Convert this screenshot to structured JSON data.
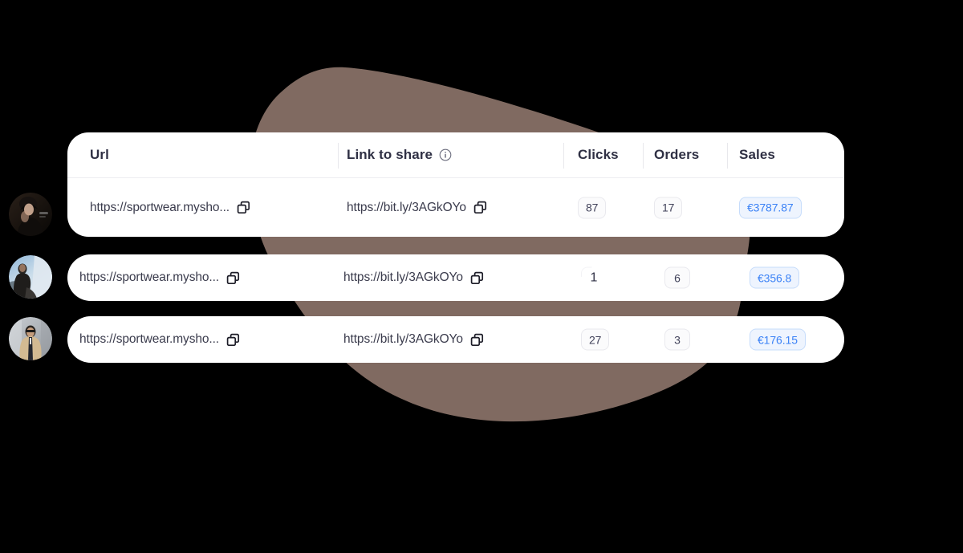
{
  "background": {
    "page_color": "#000000",
    "blob_color": "#806a61"
  },
  "table": {
    "columns": [
      {
        "key": "url",
        "label": "Url",
        "icon": null
      },
      {
        "key": "link",
        "label": "Link to share",
        "icon": "info-icon"
      },
      {
        "key": "clicks",
        "label": "Clicks",
        "icon": null
      },
      {
        "key": "orders",
        "label": "Orders",
        "icon": null
      },
      {
        "key": "sales",
        "label": "Sales",
        "icon": null
      }
    ],
    "copy_icon": "copy-icon",
    "rows": [
      {
        "url": "https://sportwear.mysho...",
        "link": "https://bit.ly/3AGkOYo",
        "clicks": "87",
        "orders": "17",
        "sales": "€3787.87",
        "clicks_badge_state": "normal"
      },
      {
        "url": "https://sportwear.mysho...",
        "link": "https://bit.ly/3AGkOYo",
        "clicks": "1",
        "orders": "6",
        "sales": "€356.8",
        "clicks_badge_state": "fading"
      },
      {
        "url": "https://sportwear.mysho...",
        "link": "https://bit.ly/3AGkOYo",
        "clicks": "27",
        "orders": "3",
        "sales": "€176.15",
        "clicks_badge_state": "normal"
      }
    ]
  },
  "avatars": [
    {
      "name": "avatar-row-1",
      "alt": "portrait photo"
    },
    {
      "name": "avatar-row-2",
      "alt": "portrait photo"
    },
    {
      "name": "avatar-row-3",
      "alt": "portrait photo"
    }
  ],
  "colors": {
    "badge_number_bg": "#fbfbfc",
    "badge_number_text": "#41425a",
    "badge_sales_bg": "#eef4fe",
    "badge_sales_border": "#c6dcfb",
    "badge_sales_text": "#3b82f6",
    "header_text": "#2f3044",
    "url_text": "#3b3c4d",
    "card_bg": "#ffffff"
  }
}
